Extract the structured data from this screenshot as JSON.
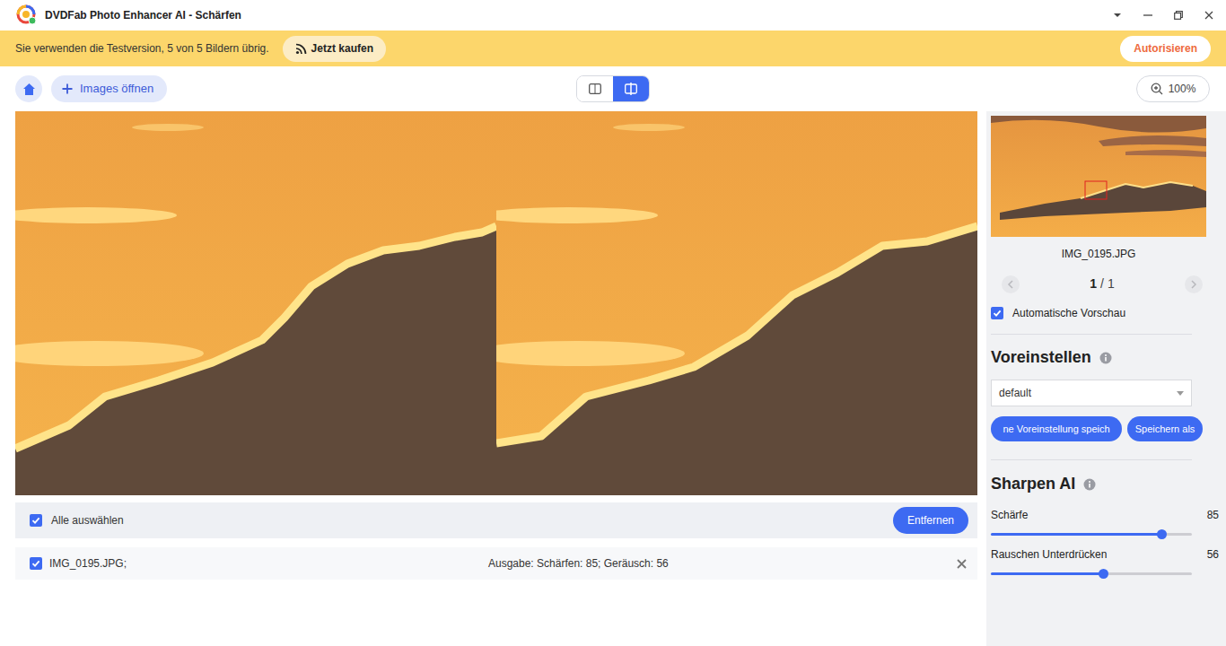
{
  "window": {
    "title": "DVDFab Photo Enhancer AI - Schärfen"
  },
  "banner": {
    "message": "Sie verwenden die Testversion, 5 von 5 Bildern übrig.",
    "buy_button": "Jetzt kaufen",
    "authorize_button": "Autorisieren"
  },
  "toolbar": {
    "open_button": "Images öffnen",
    "view_modes": [
      {
        "kind": "single",
        "selected": false
      },
      {
        "kind": "compare",
        "selected": true
      }
    ],
    "zoom": "100%"
  },
  "list": {
    "select_all": {
      "label": "Alle auswählen",
      "checked": true
    },
    "remove_button": "Entfernen",
    "items": [
      {
        "name": "IMG_0195.JPG;",
        "output": "Ausgabe: Schärfen: 85; Geräusch: 56",
        "checked": true
      }
    ]
  },
  "sidebar": {
    "filename": "IMG_0195.JPG",
    "pager": {
      "page": "1",
      "separator": "/ 1",
      "prev_disabled": true,
      "next_disabled": true
    },
    "auto_preview": {
      "label": "Automatische Vorschau",
      "checked": true
    },
    "presets": {
      "title": "Voreinstellen",
      "value": "default",
      "buttons": [
        "ne Voreinstellung speich",
        "Speichern als"
      ]
    },
    "sharpen": {
      "title": "Sharpen AI",
      "sliders": [
        {
          "label": "Schärfe",
          "value": "85",
          "level": 0.85
        },
        {
          "label": "Rauschen Unterdrücken",
          "value": "56",
          "level": 0.56
        }
      ]
    }
  }
}
